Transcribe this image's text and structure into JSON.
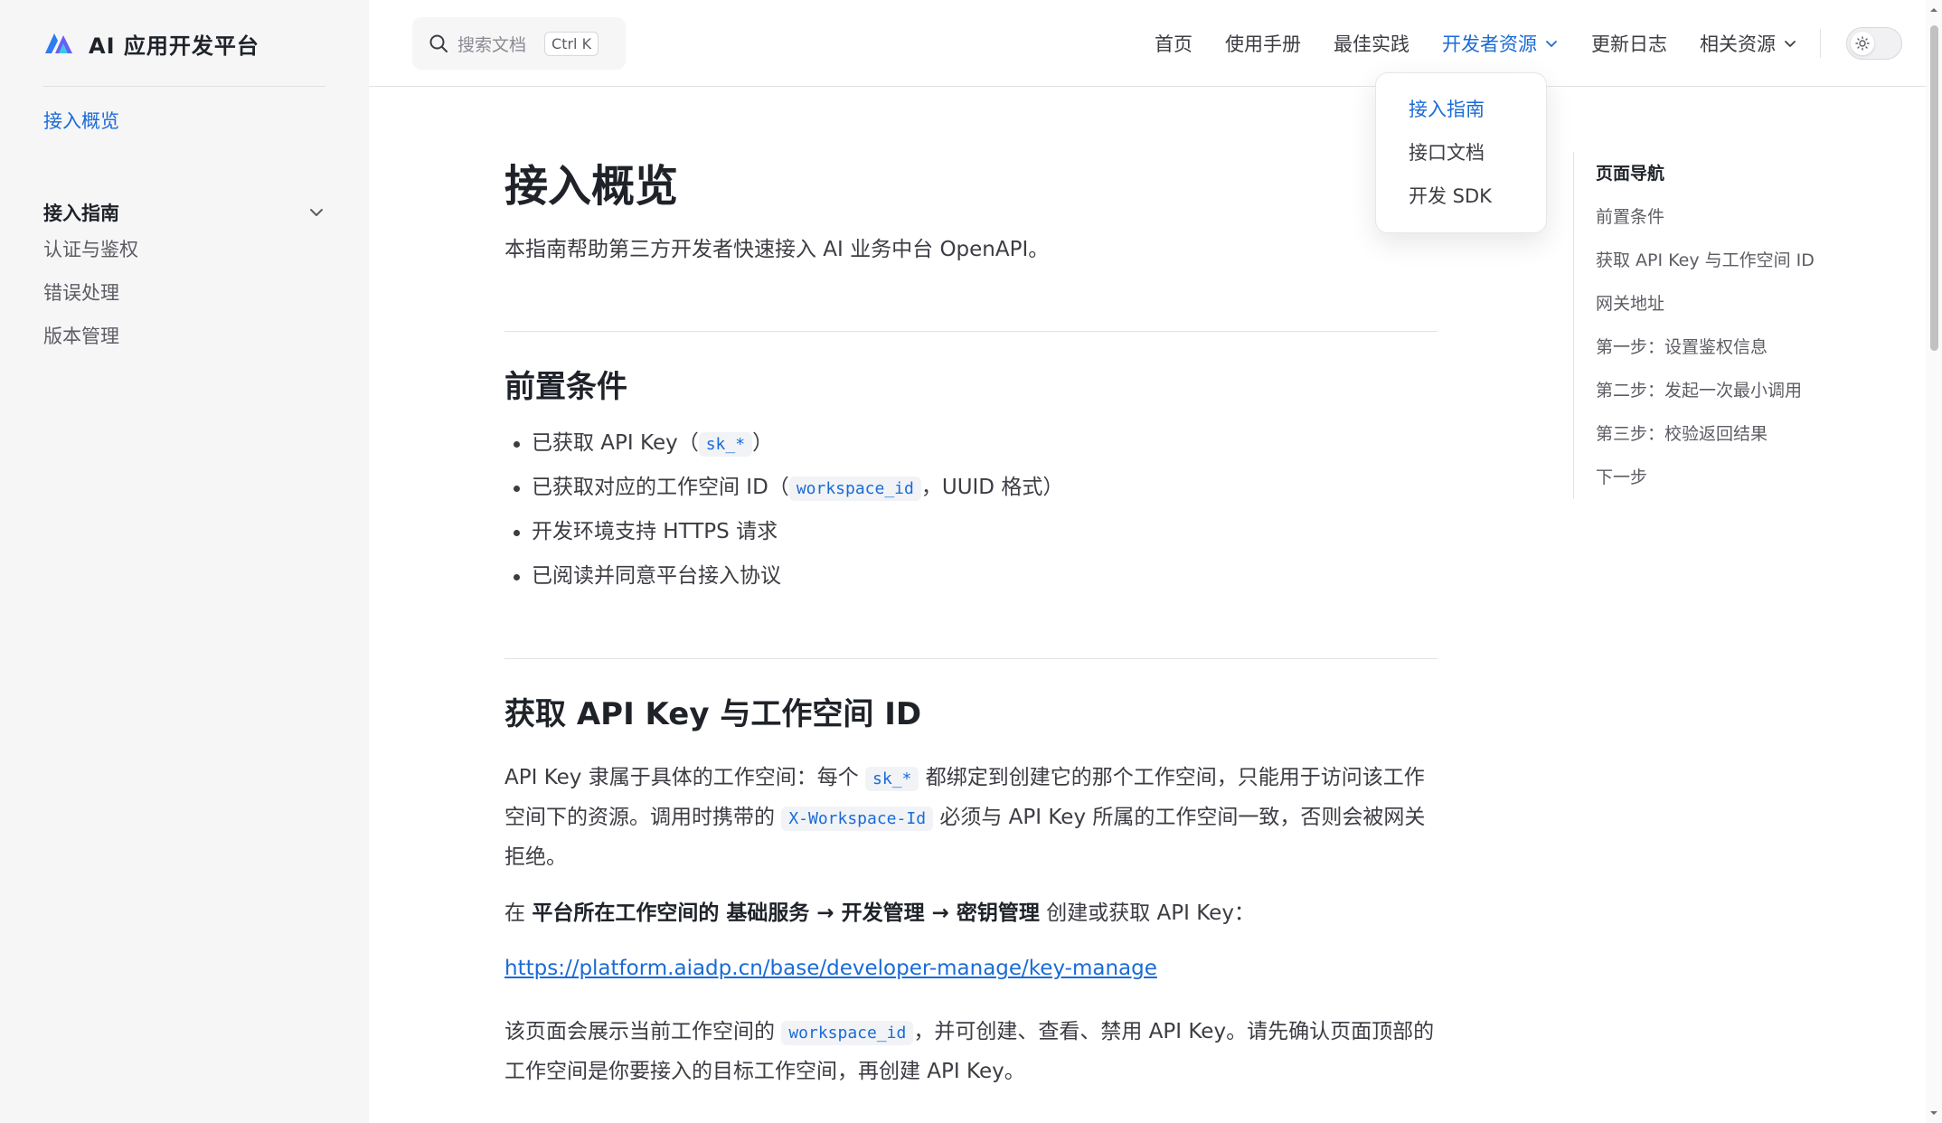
{
  "app": {
    "title": "AI 应用开发平台",
    "accent_color": "#1a6bd6"
  },
  "sidebar": {
    "active_item": "接入概览",
    "group": {
      "title": "接入指南",
      "items": [
        "认证与鉴权",
        "错误处理",
        "版本管理"
      ]
    }
  },
  "topnav": {
    "search_placeholder": "搜索文档",
    "search_shortcut": "Ctrl K",
    "items": [
      {
        "label": "首页"
      },
      {
        "label": "使用手册"
      },
      {
        "label": "最佳实践"
      },
      {
        "label": "开发者资源",
        "active": true,
        "dropdown": true
      },
      {
        "label": "更新日志"
      },
      {
        "label": "相关资源",
        "dropdown": true
      }
    ],
    "theme_icon": "sun-icon"
  },
  "dropdown": {
    "items": [
      "接入指南",
      "接口文档",
      "开发 SDK"
    ],
    "active_index": 0
  },
  "content": {
    "title": "接入概览",
    "lead": "本指南帮助第三方开发者快速接入 AI 业务中台 OpenAPI。",
    "section1": {
      "title": "前置条件",
      "bullet1_pre": "已获取 API Key（",
      "bullet1_code": "sk_*",
      "bullet1_post": "）",
      "bullet2_pre": "已获取对应的工作空间 ID（",
      "bullet2_code": "workspace_id",
      "bullet2_post": "，UUID 格式）",
      "bullet3": "开发环境支持 HTTPS 请求",
      "bullet4": "已阅读并同意平台接入协议"
    },
    "section2": {
      "title": "获取 API Key 与工作空间 ID",
      "p1_a": "API Key 隶属于具体的工作空间：每个 ",
      "p1_code1": "sk_*",
      "p1_b": " 都绑定到创建它的那个工作空间，只能用于访问该工作空间下的资源。调用时携带的 ",
      "p1_code2": "X-Workspace-Id",
      "p1_c": " 必须与 API Key 所属的工作空间一致，否则会被网关拒绝。",
      "p2_a": "在 ",
      "p2_b1": "平台所在工作空间的 基础服务 → 开发管理 → 密钥管理",
      "p2_c": " 创建或获取 API Key：",
      "link": "https://platform.aiadp.cn/base/developer-manage/key-manage",
      "p3_a": "该页面会展示当前工作空间的 ",
      "p3_code": "workspace_id",
      "p3_b": "，并可创建、查看、禁用 API Key。请先确认页面顶部的工作空间是你要接入的目标工作空间，再创建 API Key。"
    }
  },
  "outline": {
    "title": "页面导航",
    "items": [
      "前置条件",
      "获取 API Key 与工作空间 ID",
      "网关地址",
      "第一步：设置鉴权信息",
      "第二步：发起一次最小调用",
      "第三步：校验返回结果",
      "下一步"
    ]
  }
}
